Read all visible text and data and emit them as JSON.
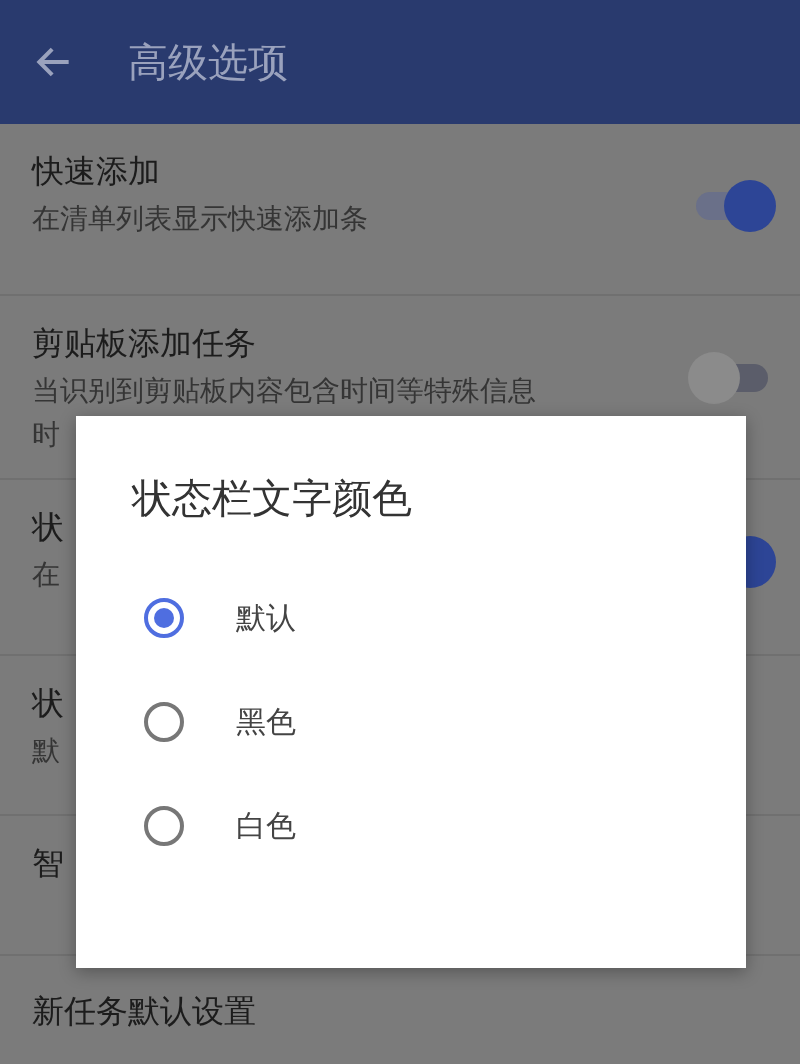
{
  "app_bar": {
    "title": "高级选项"
  },
  "settings": [
    {
      "kind": "switch",
      "title": "快速添加",
      "subtitle": [
        "在清单列表显示快速添加条"
      ],
      "on": true
    },
    {
      "kind": "switch",
      "title": "剪贴板添加任务",
      "subtitle": [
        "当识别到剪贴板内容包含时间等特殊信息",
        "时"
      ],
      "on": false
    },
    {
      "kind": "switch",
      "title": "状",
      "subtitle": [
        "在"
      ],
      "on": true
    },
    {
      "kind": "plain",
      "title": "状",
      "subtitle": [
        "默"
      ]
    },
    {
      "kind": "plain",
      "title": "智"
    },
    {
      "kind": "plain",
      "title": "新任务默认设置"
    }
  ],
  "dialog": {
    "title": "状态栏文字颜色",
    "options": [
      {
        "label": "默认",
        "selected": true
      },
      {
        "label": "黑色",
        "selected": false
      },
      {
        "label": "白色",
        "selected": false
      }
    ]
  }
}
